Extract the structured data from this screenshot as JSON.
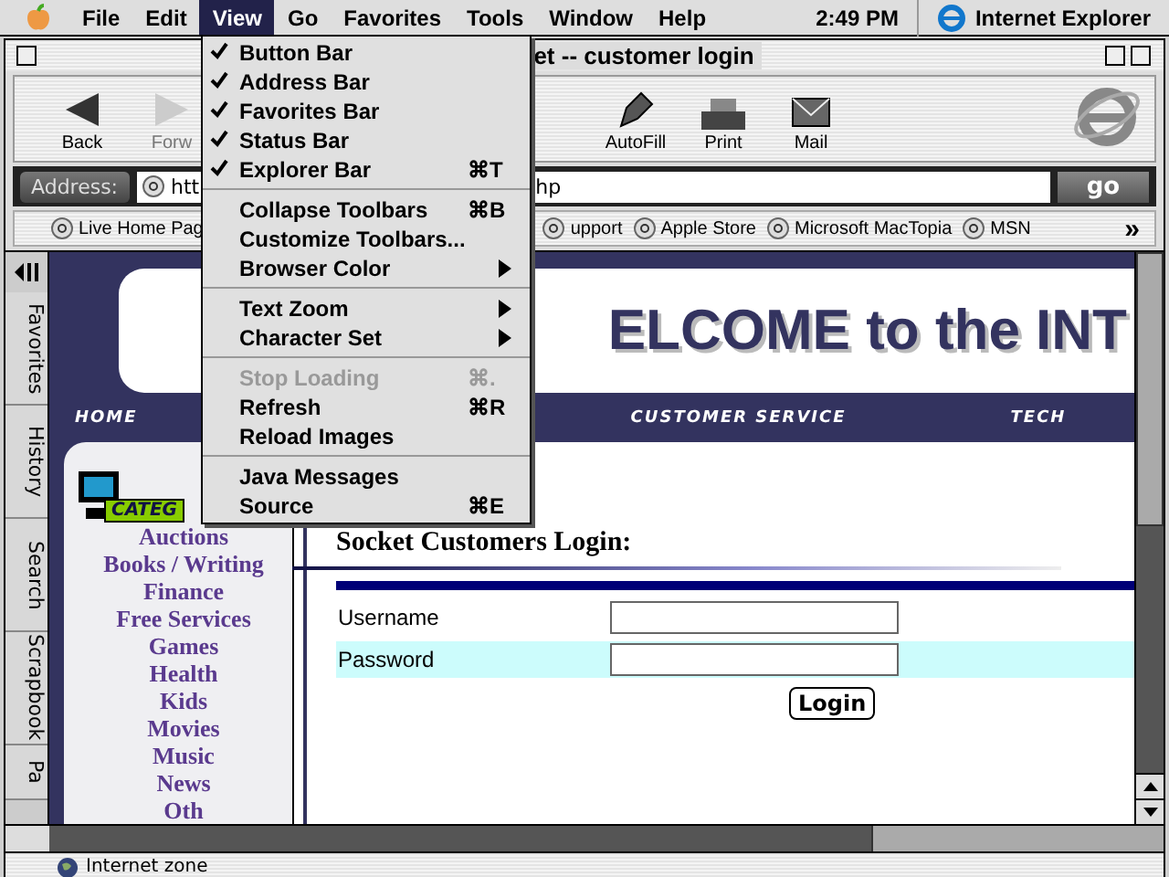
{
  "menu_bar": {
    "items": [
      {
        "label": "File",
        "selected": false
      },
      {
        "label": "Edit",
        "selected": false
      },
      {
        "label": "View",
        "selected": true
      },
      {
        "label": "Go",
        "selected": false
      },
      {
        "label": "Favorites",
        "selected": false
      },
      {
        "label": "Tools",
        "selected": false
      },
      {
        "label": "Window",
        "selected": false
      },
      {
        "label": "Help",
        "selected": false
      }
    ],
    "clock": "2:49 PM",
    "app": "Internet Explorer"
  },
  "view_menu": [
    {
      "kind": "item",
      "label": "Button Bar",
      "checked": true,
      "disabled": false
    },
    {
      "kind": "item",
      "label": "Address Bar",
      "checked": true,
      "disabled": false
    },
    {
      "kind": "item",
      "label": "Favorites Bar",
      "checked": true,
      "disabled": false
    },
    {
      "kind": "item",
      "label": "Status Bar",
      "checked": true,
      "disabled": false
    },
    {
      "kind": "item",
      "label": "Explorer Bar",
      "checked": true,
      "disabled": false,
      "shortcut": "⌘T"
    },
    {
      "kind": "separator"
    },
    {
      "kind": "item",
      "label": "Collapse Toolbars",
      "checked": false,
      "disabled": false,
      "shortcut": "⌘B"
    },
    {
      "kind": "item",
      "label": "Customize Toolbars...",
      "checked": false,
      "disabled": false
    },
    {
      "kind": "submenu",
      "label": "Browser Color",
      "checked": false,
      "disabled": false
    },
    {
      "kind": "separator"
    },
    {
      "kind": "submenu",
      "label": "Text Zoom",
      "checked": false,
      "disabled": false
    },
    {
      "kind": "submenu",
      "label": "Character Set",
      "checked": false,
      "disabled": false
    },
    {
      "kind": "separator"
    },
    {
      "kind": "item",
      "label": "Stop Loading",
      "checked": false,
      "disabled": true,
      "shortcut": "⌘."
    },
    {
      "kind": "item",
      "label": "Refresh",
      "checked": false,
      "disabled": false,
      "shortcut": "⌘R"
    },
    {
      "kind": "item",
      "label": "Reload Images",
      "checked": false,
      "disabled": false
    },
    {
      "kind": "separator"
    },
    {
      "kind": "item",
      "label": "Java Messages",
      "checked": false,
      "disabled": false
    },
    {
      "kind": "item",
      "label": "Source",
      "checked": false,
      "disabled": false,
      "shortcut": "⌘E"
    }
  ],
  "window": {
    "title": "et -- customer login"
  },
  "toolbar": [
    {
      "kind": "back",
      "label": "Back",
      "disabled": false
    },
    {
      "kind": "forward",
      "label": "Forw",
      "disabled": true
    },
    {
      "kind": "autofill",
      "label": "AutoFill",
      "disabled": false
    },
    {
      "kind": "print",
      "label": "Print",
      "disabled": false
    },
    {
      "kind": "mail",
      "label": "Mail",
      "disabled": false
    }
  ],
  "address_bar": {
    "label": "Address:",
    "url_start": "htt",
    "url_end": "hp",
    "go": "go"
  },
  "favorites_bar": {
    "items": [
      "Live Home Pag",
      "upport",
      "Apple Store",
      "Microsoft MacTopia",
      "MSN"
    ],
    "more": "»"
  },
  "explorer_tabs": [
    "Favorites",
    "History",
    "Search",
    "Scrapbook",
    "Pa"
  ],
  "page": {
    "banner": "ELCOME to the INT",
    "nav": [
      "HOME",
      "CUSTOMER SERVICE",
      "TECH"
    ],
    "categories_logo": "CATEG",
    "categories": [
      "Auctions",
      "Books / Writing",
      "Finance",
      "Free Services",
      "Games",
      "Health",
      "Kids",
      "Movies",
      "Music",
      "News",
      "Oth"
    ],
    "login": {
      "heading": "Socket Customers Login:",
      "fields": [
        {
          "label": "Username",
          "highlighted": false
        },
        {
          "label": "Password",
          "highlighted": true
        }
      ],
      "button": "Login"
    }
  },
  "status_bar": {
    "text": "Internet zone"
  }
}
